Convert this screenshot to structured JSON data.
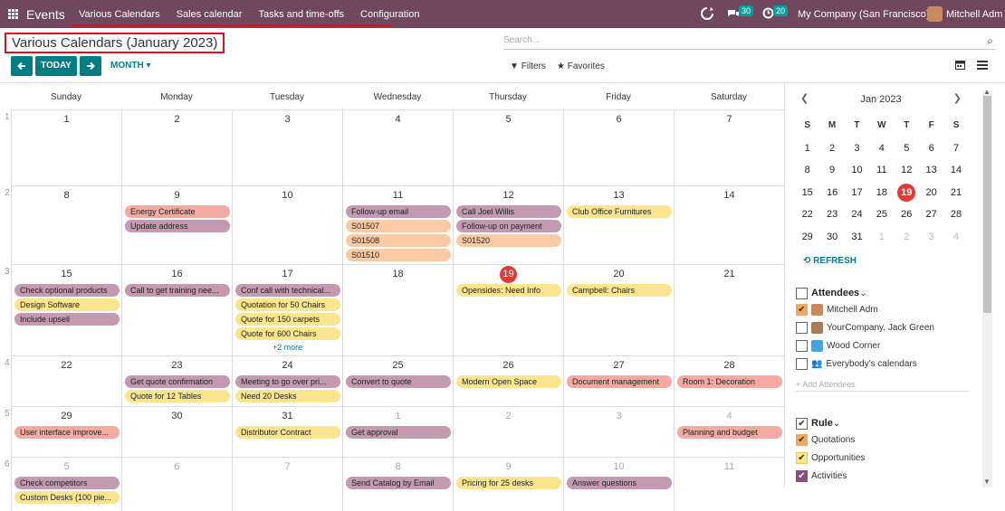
{
  "topbar": {
    "app": "Events",
    "menu": [
      "Various Calendars",
      "Sales calendar",
      "Tasks and time-offs",
      "Configuration"
    ],
    "messages_badge": "30",
    "activities_badge": "20",
    "company": "My Company (San Francisco)",
    "user": "Mitchell Adm"
  },
  "title": "Various Calendars (January 2023)",
  "search": {
    "placeholder": "Search..."
  },
  "toolbar": {
    "today": "TODAY",
    "month": "MONTH",
    "filters": "Filters",
    "favorites": "Favorites"
  },
  "colors": {
    "topbar": "#71465f",
    "accent": "#017e84",
    "today": "#e43935",
    "purple": "#c49ab2",
    "salmon": "#f4a9a1",
    "yellow": "#fbe58f",
    "peach": "#fbcaa4"
  },
  "calendar": {
    "days": [
      "Sunday",
      "Monday",
      "Tuesday",
      "Wednesday",
      "Thursday",
      "Friday",
      "Saturday"
    ],
    "weeks": [
      {
        "num": "1",
        "dates": [
          "1",
          "2",
          "3",
          "4",
          "5",
          "6",
          "7"
        ]
      },
      {
        "num": "2",
        "dates": [
          "8",
          "9",
          "10",
          "11",
          "12",
          "13",
          "14"
        ]
      },
      {
        "num": "3",
        "dates": [
          "15",
          "16",
          "17",
          "18",
          "19",
          "20",
          "21"
        ]
      },
      {
        "num": "4",
        "dates": [
          "22",
          "23",
          "24",
          "25",
          "26",
          "27",
          "28"
        ]
      },
      {
        "num": "5",
        "dates": [
          "29",
          "30",
          "31",
          "1",
          "2",
          "3",
          "4"
        ]
      },
      {
        "num": "6",
        "dates": [
          "5",
          "6",
          "7",
          "8",
          "9",
          "10",
          "11"
        ]
      }
    ],
    "events": [
      {
        "week": 1,
        "day": 1,
        "slot": 0,
        "label": "Energy Certificate",
        "color": "salmon"
      },
      {
        "week": 1,
        "day": 1,
        "slot": 1,
        "label": "Update address",
        "color": "purple"
      },
      {
        "week": 1,
        "day": 3,
        "slot": 0,
        "label": "Follow-up email",
        "color": "purple"
      },
      {
        "week": 1,
        "day": 3,
        "slot": 1,
        "label": "S01507",
        "color": "peach"
      },
      {
        "week": 1,
        "day": 3,
        "slot": 2,
        "label": "S01508",
        "color": "peach"
      },
      {
        "week": 1,
        "day": 3,
        "slot": 3,
        "label": "S01510",
        "color": "peach"
      },
      {
        "week": 1,
        "day": 4,
        "slot": 0,
        "label": "Call Joel Willis",
        "color": "purple"
      },
      {
        "week": 1,
        "day": 4,
        "slot": 1,
        "label": "Follow-up on payment",
        "color": "purple"
      },
      {
        "week": 1,
        "day": 4,
        "slot": 2,
        "label": "S01520",
        "color": "peach"
      },
      {
        "week": 1,
        "day": 5,
        "slot": 0,
        "label": "Club Office Furnitures",
        "color": "yellow"
      },
      {
        "week": 2,
        "day": 0,
        "slot": 0,
        "label": "Check optional products",
        "color": "purple"
      },
      {
        "week": 2,
        "day": 0,
        "slot": 1,
        "label": "Design Software",
        "color": "yellow"
      },
      {
        "week": 2,
        "day": 0,
        "slot": 2,
        "label": "Include upsell",
        "color": "purple"
      },
      {
        "week": 2,
        "day": 1,
        "slot": 0,
        "label": "Call to get training nee...",
        "color": "purple"
      },
      {
        "week": 2,
        "day": 2,
        "slot": 0,
        "label": "Conf call with technical...",
        "color": "purple"
      },
      {
        "week": 2,
        "day": 2,
        "slot": 1,
        "label": "Quotation for 50 Chairs",
        "color": "yellow"
      },
      {
        "week": 2,
        "day": 2,
        "slot": 2,
        "label": "Quote for 150 carpets",
        "color": "yellow"
      },
      {
        "week": 2,
        "day": 2,
        "slot": 3,
        "label": "Quote for 600 Chairs",
        "color": "yellow"
      },
      {
        "week": 2,
        "day": 4,
        "slot": 0,
        "label": "Opensides: Need Info",
        "color": "yellow"
      },
      {
        "week": 2,
        "day": 5,
        "slot": 0,
        "label": "Campbell: Chairs",
        "color": "yellow"
      },
      {
        "week": 3,
        "day": 1,
        "slot": 0,
        "label": "Get quote confirmation",
        "color": "purple"
      },
      {
        "week": 3,
        "day": 1,
        "slot": 1,
        "label": "Quote for 12 Tables",
        "color": "yellow"
      },
      {
        "week": 3,
        "day": 2,
        "slot": 0,
        "label": "Meeting to go over pri...",
        "color": "purple"
      },
      {
        "week": 3,
        "day": 2,
        "slot": 1,
        "label": "Need 20 Desks",
        "color": "yellow"
      },
      {
        "week": 3,
        "day": 3,
        "slot": 0,
        "label": "Convert to quote",
        "color": "purple"
      },
      {
        "week": 3,
        "day": 4,
        "slot": 0,
        "label": "Modern Open Space",
        "color": "yellow"
      },
      {
        "week": 3,
        "day": 5,
        "slot": 0,
        "label": "Document management",
        "color": "salmon"
      },
      {
        "week": 3,
        "day": 6,
        "slot": 0,
        "label": "Room 1: Decoration",
        "color": "salmon"
      },
      {
        "week": 4,
        "day": 0,
        "slot": 0,
        "label": "User interface improve...",
        "color": "salmon"
      },
      {
        "week": 4,
        "day": 2,
        "slot": 0,
        "label": "Distributor Contract",
        "color": "yellow"
      },
      {
        "week": 4,
        "day": 3,
        "slot": 0,
        "label": "Get approval",
        "color": "purple"
      },
      {
        "week": 4,
        "day": 6,
        "slot": 0,
        "label": "Planning and budget",
        "color": "salmon"
      },
      {
        "week": 5,
        "day": 0,
        "slot": 0,
        "label": "Check competitors",
        "color": "purple"
      },
      {
        "week": 5,
        "day": 0,
        "slot": 1,
        "label": "Custom Desks (100 pie...",
        "color": "yellow"
      },
      {
        "week": 5,
        "day": 3,
        "slot": 0,
        "label": "Send Catalog by Email",
        "color": "purple"
      },
      {
        "week": 5,
        "day": 4,
        "slot": 0,
        "label": "Pricing for 25 desks",
        "color": "yellow"
      },
      {
        "week": 5,
        "day": 5,
        "slot": 0,
        "label": "Answer questions",
        "color": "purple"
      }
    ],
    "more": "+2 more"
  },
  "mini": {
    "title": "Jan 2023",
    "heads": [
      "S",
      "M",
      "T",
      "W",
      "T",
      "F",
      "S"
    ],
    "rows": [
      [
        "1",
        "2",
        "3",
        "4",
        "5",
        "6",
        "7"
      ],
      [
        "8",
        "9",
        "10",
        "11",
        "12",
        "13",
        "14"
      ],
      [
        "15",
        "16",
        "17",
        "18",
        "19",
        "20",
        "21"
      ],
      [
        "22",
        "23",
        "24",
        "25",
        "26",
        "27",
        "28"
      ],
      [
        "29",
        "30",
        "31",
        "1",
        "2",
        "3",
        "4"
      ]
    ],
    "refresh": "REFRESH"
  },
  "attendees": {
    "title": "Attendees",
    "items": [
      {
        "label": "Mitchell Adm",
        "checked": true
      },
      {
        "label": "YourCompany, Jack Green",
        "checked": false
      },
      {
        "label": "Wood Corner",
        "checked": false
      },
      {
        "label": "Everybody's calendars",
        "checked": false
      }
    ],
    "add": "+ Add Attendees"
  },
  "rule": {
    "title": "Rule",
    "items": [
      {
        "label": "Quotations",
        "color": "#f0a860"
      },
      {
        "label": "Opportunities",
        "color": "#fbe58f"
      },
      {
        "label": "Activities",
        "color": "#8a4f79"
      }
    ]
  }
}
